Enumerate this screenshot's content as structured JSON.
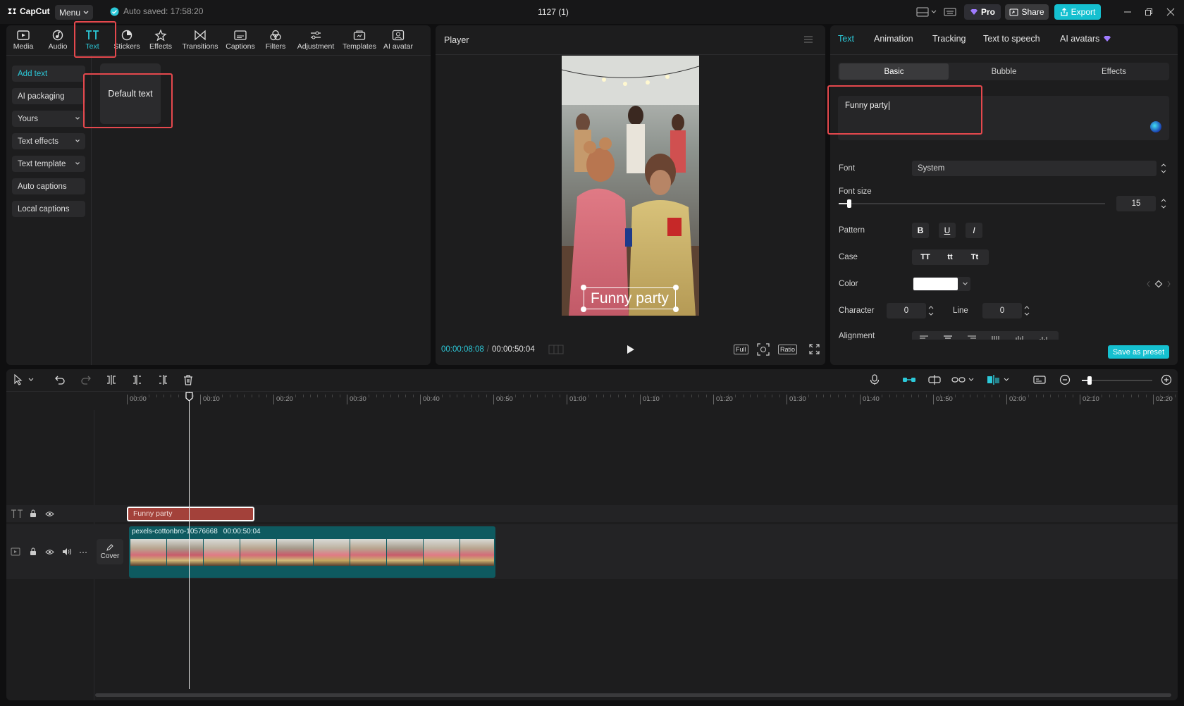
{
  "app": {
    "name": "CapCut",
    "project_title": "1127 (1)",
    "autosave": "Auto saved: 17:58:20"
  },
  "topbar": {
    "menu_label": "Menu",
    "pro_label": "Pro",
    "share_label": "Share",
    "export_label": "Export"
  },
  "toolbar": [
    {
      "label": "Media",
      "icon": "media-icon"
    },
    {
      "label": "Audio",
      "icon": "audio-icon"
    },
    {
      "label": "Text",
      "icon": "text-icon"
    },
    {
      "label": "Stickers",
      "icon": "stickers-icon"
    },
    {
      "label": "Effects",
      "icon": "effects-icon"
    },
    {
      "label": "Transitions",
      "icon": "transitions-icon"
    },
    {
      "label": "Captions",
      "icon": "captions-icon"
    },
    {
      "label": "Filters",
      "icon": "filters-icon"
    },
    {
      "label": "Adjustment",
      "icon": "adjustment-icon"
    },
    {
      "label": "Templates",
      "icon": "templates-icon"
    },
    {
      "label": "AI avatar",
      "icon": "ai-avatar-icon"
    }
  ],
  "sidebar": {
    "items": [
      {
        "label": "Add text"
      },
      {
        "label": "AI packaging"
      },
      {
        "label": "Yours"
      },
      {
        "label": "Text effects"
      },
      {
        "label": "Text template"
      },
      {
        "label": "Auto captions"
      },
      {
        "label": "Local captions"
      }
    ]
  },
  "content": {
    "default_text_card": "Default text"
  },
  "player": {
    "title": "Player",
    "overlay_text": "Funny party",
    "current_time": "00:00:08:08",
    "total_time": "00:00:50:04",
    "full_label": "Full",
    "ratio_label": "Ratio"
  },
  "inspector": {
    "tabs": [
      "Text",
      "Animation",
      "Tracking",
      "Text to speech",
      "AI avatars"
    ],
    "subtabs": [
      "Basic",
      "Bubble",
      "Effects"
    ],
    "text_value": "Funny party",
    "font_label": "Font",
    "font_value": "System",
    "font_size_label": "Font size",
    "font_size_value": "15",
    "font_size_fraction": 0.04,
    "pattern_label": "Pattern",
    "pattern_buttons": [
      "B",
      "U",
      "I"
    ],
    "case_label": "Case",
    "case_buttons": [
      "TT",
      "tt",
      "Tt"
    ],
    "color_label": "Color",
    "color_value": "#ffffff",
    "character_label": "Character",
    "character_value": "0",
    "line_label": "Line",
    "line_value": "0",
    "alignment_label": "Alignment",
    "save_preset_label": "Save as preset"
  },
  "timeline": {
    "ticks": [
      "00:00",
      "00:10",
      "00:20",
      "00:30",
      "00:40",
      "00:50",
      "01:00",
      "01:10",
      "01:20",
      "01:30",
      "01:40",
      "01:50",
      "02:00",
      "02:10",
      "02:20"
    ],
    "text_clip_label": "Funny party",
    "video_clip_name": "pexels-cottonbro-10576668",
    "video_clip_duration": "00:00:50:04",
    "cover_label": "Cover"
  },
  "colors": {
    "accent": "#2cc9d9",
    "text_clip": "#a3413a",
    "video_clip": "#0e5a60",
    "highlight": "#e5484d"
  }
}
